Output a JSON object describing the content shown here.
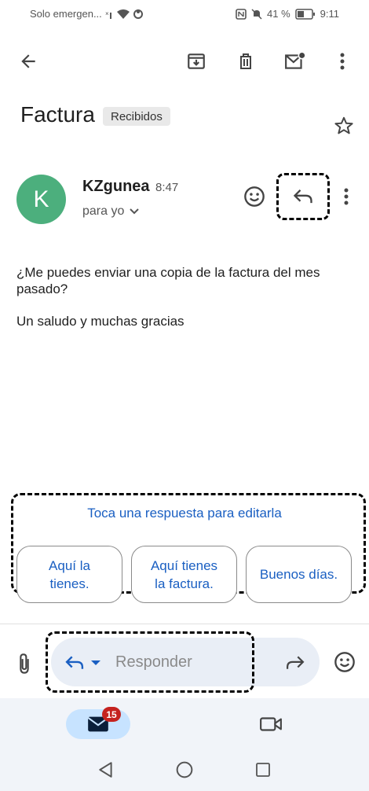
{
  "status_bar": {
    "carrier": "Solo emergen...",
    "battery": "41 %",
    "time": "9:11"
  },
  "email": {
    "subject": "Factura",
    "label": "Recibidos",
    "sender_initial": "K",
    "sender": "KZgunea",
    "time": "8:47",
    "recipient": "para yo",
    "body_line1": "¿Me puedes enviar una copia de la factura del mes",
    "body_line2": "pasado?",
    "body_line3": "Un saludo y muchas gracias"
  },
  "smart_reply": {
    "hint": "Toca una respuesta para editarla",
    "chips": [
      {
        "line1": "Aquí la",
        "line2": "tienes."
      },
      {
        "line1": "Aquí tienes",
        "line2": "la factura."
      },
      {
        "line1": "Buenos días.",
        "line2": ""
      }
    ]
  },
  "compose": {
    "placeholder": "Responder"
  },
  "bottom_nav": {
    "mail_badge": "15"
  },
  "colors": {
    "accent": "#1a5fc2",
    "avatar": "#4caf7d",
    "badge": "#c5221f",
    "nav_pill": "#c7e3ff"
  }
}
